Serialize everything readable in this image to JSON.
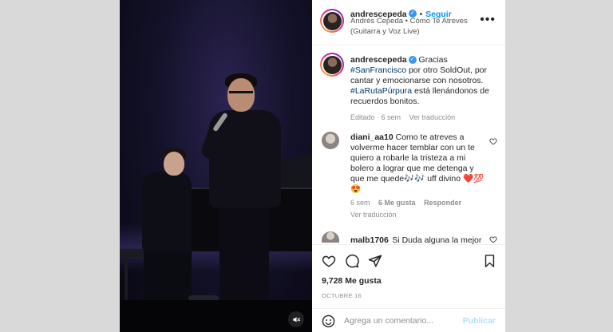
{
  "header": {
    "username": "andrescepeda",
    "follow_label": "Seguir",
    "separator": "•",
    "subtitle_line1": "Andrés Cepeda • Cómo Te Atreves",
    "subtitle_line2": "(Guitarra y Voz Live)",
    "more_icon": "more-horizontal-icon"
  },
  "caption": {
    "username": "andrescepeda",
    "text_1": "Gracias",
    "hashtag_1": "#SanFrancisco",
    "text_2": "por otro SoldOut, por",
    "line_3": "cantar y emocionarse con nosotros.",
    "hashtag_2": "#LaRutaPúrpura",
    "text_3": "está llenándonos de",
    "line_5": "recuerdos bonitos.",
    "edited_label": "Editado · 6 sem",
    "translate_label": "Ver traducción"
  },
  "comments": [
    {
      "username": "diani_aa10",
      "line_1": "Como te atreves a",
      "line_2": "volverme hacer temblar con un te",
      "line_3": "quiero a robarle la tristeza a mi",
      "line_4": "bolero a lograr que me detenga y",
      "line_5": "que me quede🎶🎶 uff divino ❤️💯",
      "line_6": "😍",
      "time": "6 sem",
      "likes": "6 Me gusta",
      "reply_label": "Responder",
      "translate_label": "Ver traducción"
    },
    {
      "username": "malb1706",
      "text": "Si Duda alguna la mejor"
    }
  ],
  "actions": {
    "like_icon": "heart-icon",
    "comment_icon": "comment-icon",
    "share_icon": "send-icon",
    "save_icon": "bookmark-icon"
  },
  "likes_count": "9,728 Me gusta",
  "date": "OCTUBRE 16",
  "add_comment": {
    "placeholder": "Agrega un comentario...",
    "post_label": "Publicar",
    "emoji_icon": "emoji-icon"
  },
  "media": {
    "mute_icon": "volume-muted-icon"
  },
  "colors": {
    "background": "#d9d9d9",
    "link_blue": "#0095f6",
    "hashtag": "#00376b",
    "muted_text": "#8e8e8e",
    "post_disabled": "#b2dffc"
  }
}
